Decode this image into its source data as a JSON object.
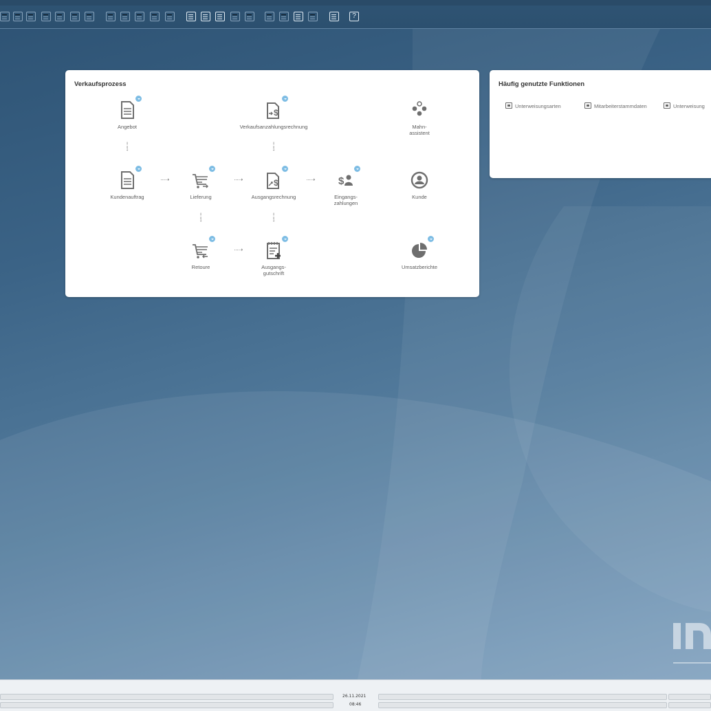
{
  "panels": {
    "sales": {
      "title": "Verkaufsprozess",
      "nodes": {
        "angebot": "Angebot",
        "verkaufsanzahlungsrechnung": "Verkaufsanzahlungsrechnung",
        "mahnassistent_1": "Mahn-",
        "mahnassistent_2": "assistent",
        "kundenauftrag": "Kundenauftrag",
        "lieferung": "Lieferung",
        "ausgangsrechnung": "Ausgangsrechnung",
        "eingangszahlungen_1": "Eingangs-",
        "eingangszahlungen_2": "zahlungen",
        "kunde": "Kunde",
        "retoure": "Retoure",
        "ausgangsgutschrift_1": "Ausgangs-",
        "ausgangsgutschrift_2": "gutschrift",
        "umsatzberichte": "Umsatzberichte"
      }
    },
    "favorites": {
      "title": "Häufig genutzte Funktionen",
      "items": [
        "Unterweisungsarten",
        "Mitarbeiterstammdaten",
        "Unterweisung"
      ]
    }
  },
  "statusbar": {
    "date": "26.11.2021",
    "time": "08:46"
  },
  "colors": {
    "badge": "#7ebde4",
    "icon": "#6e6e6e"
  }
}
